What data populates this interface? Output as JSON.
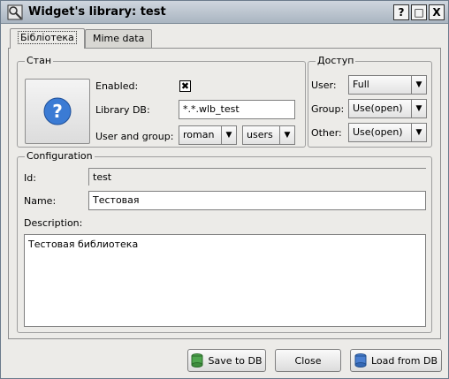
{
  "window": {
    "title": "Widget's library: test"
  },
  "titlebar_buttons": {
    "help": "?",
    "maximize": "□",
    "close": "X"
  },
  "tabs": [
    {
      "label": "Бібліотека",
      "active": true
    },
    {
      "label": "Mime data",
      "active": false
    }
  ],
  "state_group": {
    "legend": "Стан",
    "enabled_label": "Enabled:",
    "enabled_checked": true,
    "enabled_mark": "✖",
    "library_db_label": "Library DB:",
    "library_db_value": "*.*.wlb_test",
    "user_group_label": "User and group:",
    "user_value": "roman",
    "group_value": "users"
  },
  "access_group": {
    "legend": "Доступ",
    "user_label": "User:",
    "user_value": "Full",
    "group_label": "Group:",
    "group_value": "Use(open)",
    "other_label": "Other:",
    "other_value": "Use(open)"
  },
  "configuration": {
    "legend": "Configuration",
    "id_label": "Id:",
    "id_value": "test",
    "name_label": "Name:",
    "name_value": "Тестовая",
    "description_label": "Description:",
    "description_value": "Тестовая библиотека"
  },
  "buttons": {
    "save": "Save to DB",
    "close": "Close",
    "load": "Load from DB"
  },
  "colors": {
    "help_icon": "#3b7bd4",
    "accent": "#aab5c1"
  }
}
